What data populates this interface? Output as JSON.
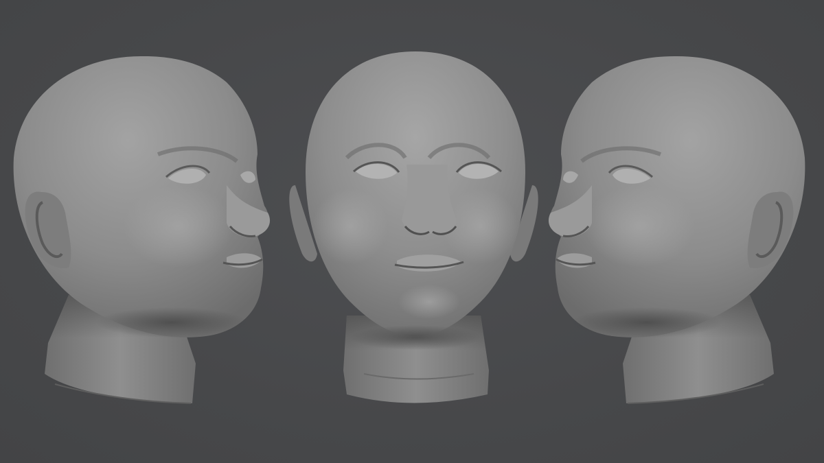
{
  "scene": {
    "background_color": "#48494b",
    "model_color": "#8a8a8a",
    "views": [
      {
        "name": "head-left-three-quarter-view",
        "facing": "right"
      },
      {
        "name": "head-front-view",
        "facing": "front"
      },
      {
        "name": "head-right-three-quarter-view",
        "facing": "left"
      }
    ]
  }
}
